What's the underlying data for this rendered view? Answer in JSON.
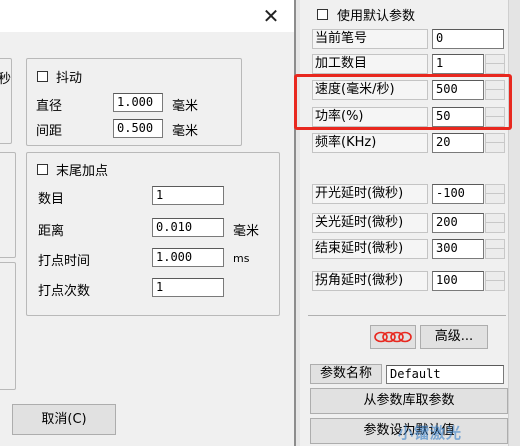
{
  "dialog": {
    "close_glyph": "✕",
    "cut_char": "秒",
    "jitter": {
      "checkbox_label": "抖动",
      "diameter_label": "直径",
      "diameter_value": "1.000",
      "spacing_label": "间距",
      "spacing_value": "0.500",
      "unit": "毫米"
    },
    "tail": {
      "checkbox_label": "末尾加点",
      "count_label": "数目",
      "count_value": "1",
      "distance_label": "距离",
      "distance_value": "0.010",
      "distance_unit": "毫米",
      "dot_time_label": "打点时间",
      "dot_time_value": "1.000",
      "dot_time_unit": "ms",
      "dot_count_label": "打点次数",
      "dot_count_value": "1"
    },
    "cancel_label": "取消(C)"
  },
  "params": {
    "use_default_label": "使用默认参数",
    "rows": [
      {
        "label": "当前笔号",
        "value": "0",
        "spin": false
      },
      {
        "label": "加工数目",
        "value": "1",
        "spin": true
      },
      {
        "label": "速度(毫米/秒)",
        "value": "500",
        "spin": true
      },
      {
        "label": "功率(%)",
        "value": "50",
        "spin": true
      },
      {
        "label": "频率(KHz)",
        "value": "20",
        "spin": true
      }
    ],
    "delays": [
      {
        "label": "开光延时(微秒)",
        "value": "-100"
      },
      {
        "label": "关光延时(微秒)",
        "value": "200"
      },
      {
        "label": "结束延时(微秒)",
        "value": "300"
      },
      {
        "label": "拐角延时(微秒)",
        "value": "100"
      }
    ],
    "advanced_label": "高级...",
    "param_name_label": "参数名称",
    "param_name_value": "Default",
    "load_button_label": "从参数库取参数",
    "save_button_label": "参数设为默认值"
  },
  "watermark": "小镭激光",
  "colors": {
    "highlight": "#e8281f"
  }
}
